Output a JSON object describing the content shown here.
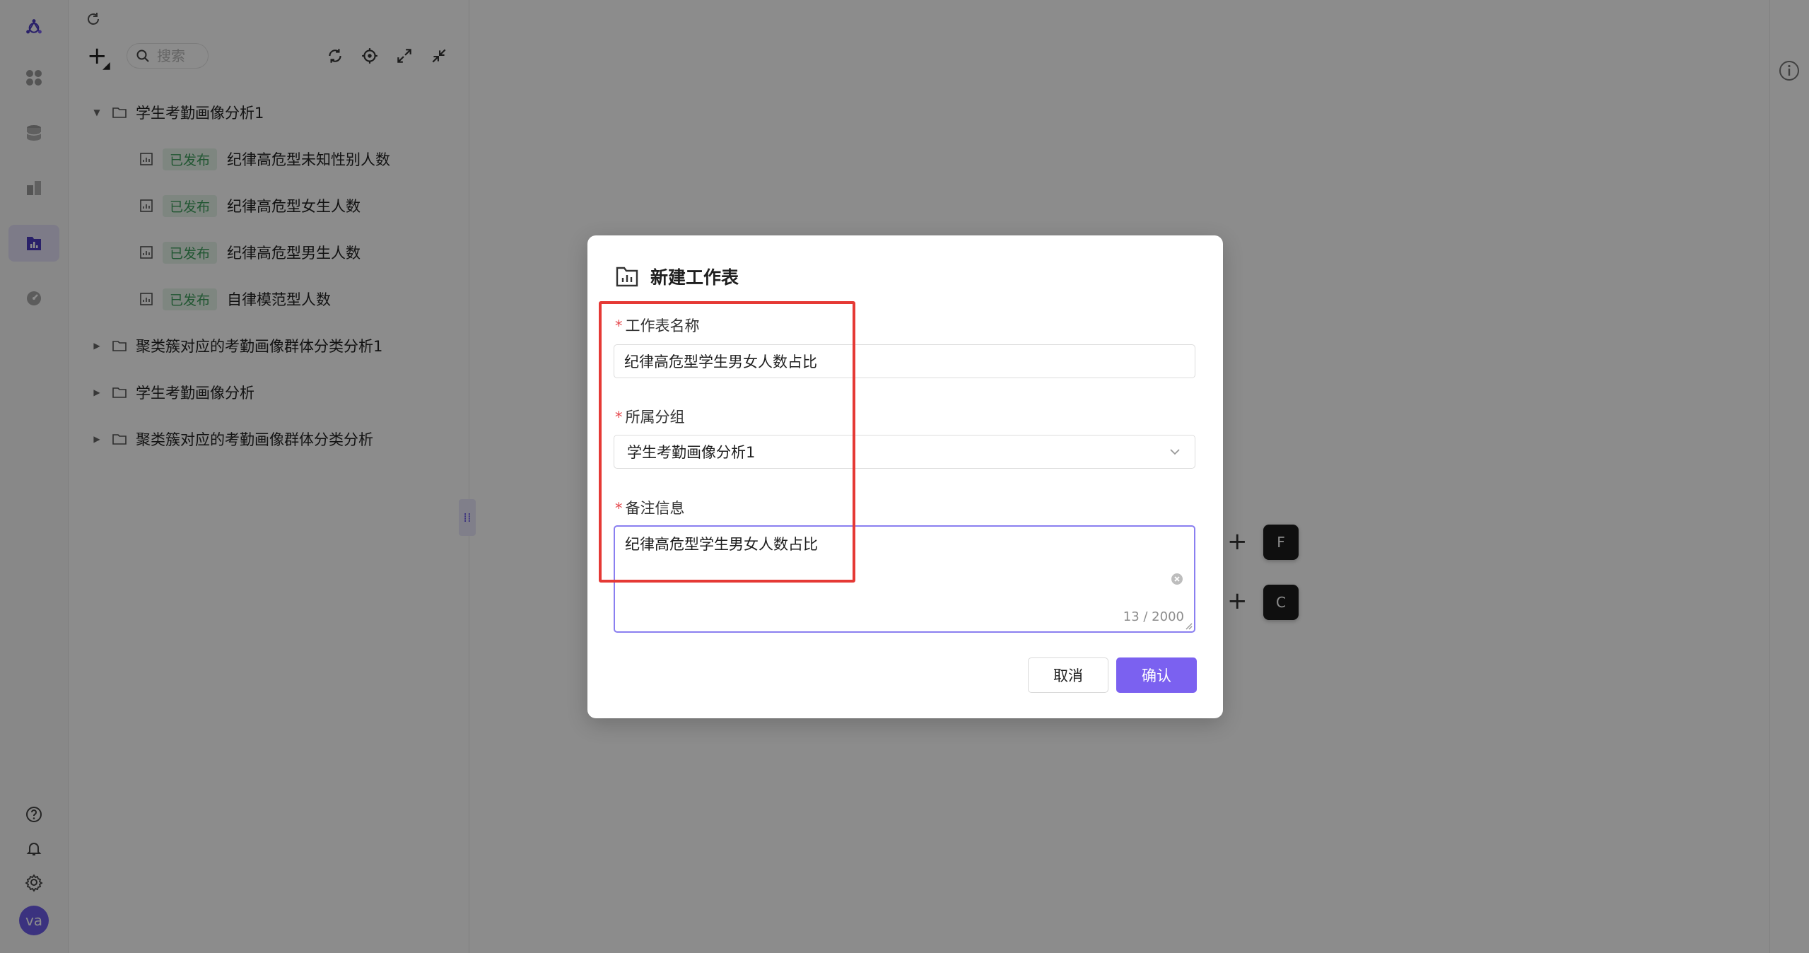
{
  "search": {
    "placeholder": "搜索"
  },
  "tree": {
    "groups": [
      {
        "label": "学生考勤画像分析1",
        "expanded": true,
        "items": [
          {
            "badge": "已发布",
            "label": "纪律高危型未知性别人数"
          },
          {
            "badge": "已发布",
            "label": "纪律高危型女生人数"
          },
          {
            "badge": "已发布",
            "label": "纪律高危型男生人数"
          },
          {
            "badge": "已发布",
            "label": "自律模范型人数"
          }
        ]
      },
      {
        "label": "聚类簇对应的考勤画像群体分类分析1",
        "expanded": false
      },
      {
        "label": "学生考勤画像分析",
        "expanded": false
      },
      {
        "label": "聚类簇对应的考勤画像群体分类分析",
        "expanded": false
      }
    ]
  },
  "avatar": {
    "initials": "va"
  },
  "canvas": {
    "plus_symbol": "+",
    "chips": [
      {
        "key": "F"
      },
      {
        "key": "C"
      }
    ]
  },
  "modal": {
    "title": "新建工作表",
    "required_mark": "*",
    "name_label": "工作表名称",
    "name_value": "纪律高危型学生男女人数占比",
    "group_label": "所属分组",
    "group_value": "学生考勤画像分析1",
    "note_label": "备注信息",
    "note_value": "纪律高危型学生男女人数占比",
    "note_counter": "13 / 2000",
    "cancel_label": "取消",
    "confirm_label": "确认"
  },
  "colors": {
    "accent": "#7b61f0",
    "badge_bg": "#e6f4ea",
    "badge_text": "#3c9d5b",
    "required": "#e5484d",
    "highlight": "#e53935"
  },
  "icons": {
    "logo": "logo-icon",
    "dashboard": "grid-icon",
    "database": "database-icon",
    "dataset": "dataset-icon",
    "worksheet": "worksheet-icon",
    "monitor": "gauge-icon",
    "help": "help-icon",
    "bell": "bell-icon",
    "settings": "gear-icon",
    "info": "info-icon"
  }
}
